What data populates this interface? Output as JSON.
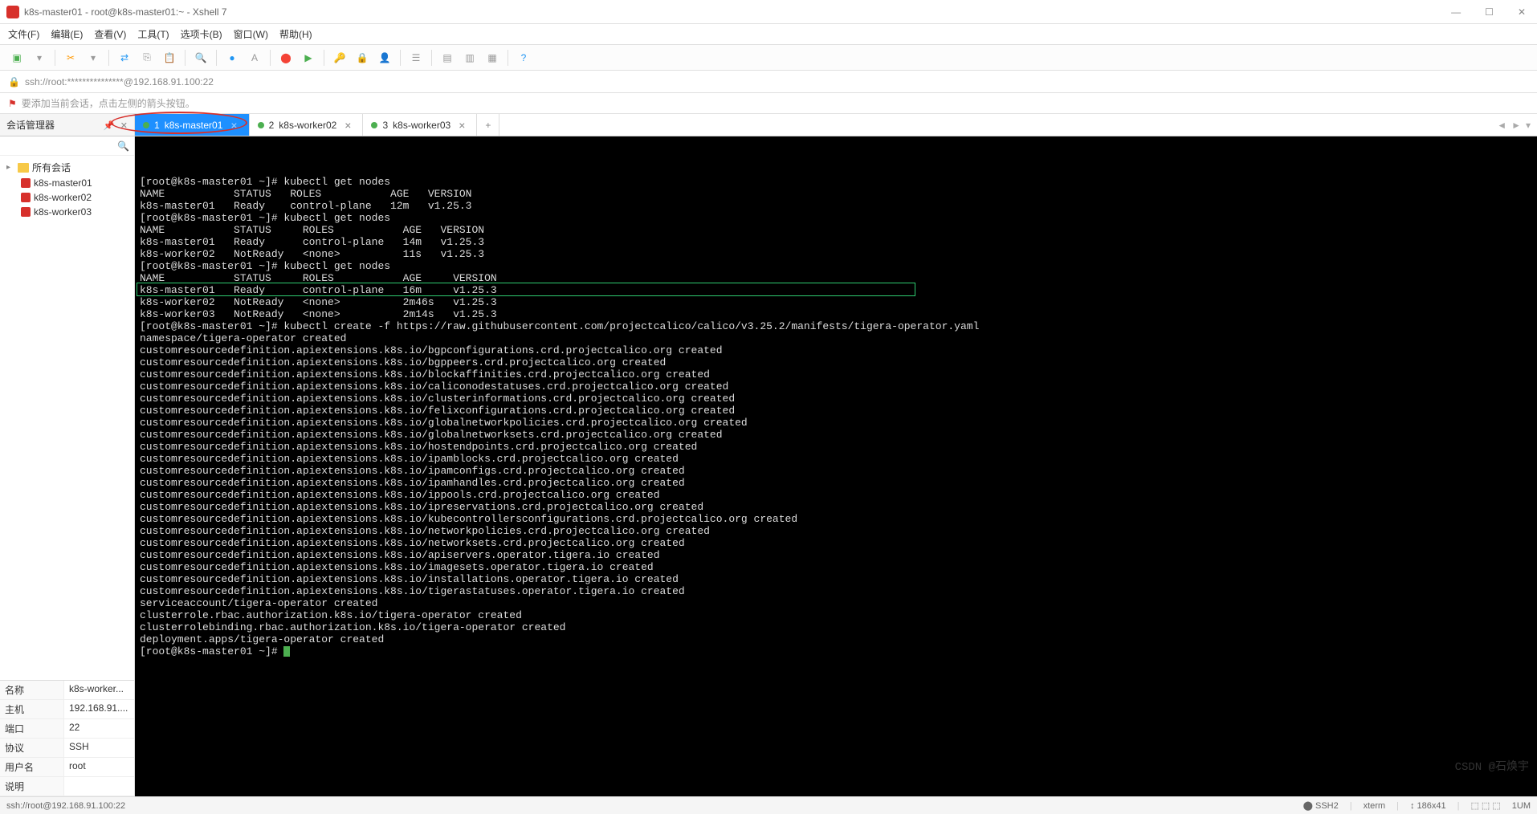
{
  "window": {
    "title": "k8s-master01 - root@k8s-master01:~ - Xshell 7",
    "min": "—",
    "max": "☐",
    "close": "✕"
  },
  "menu": [
    "文件(F)",
    "编辑(E)",
    "查看(V)",
    "工具(T)",
    "选项卡(B)",
    "窗口(W)",
    "帮助(H)"
  ],
  "address": "ssh://root:***************@192.168.91.100:22",
  "hint": "要添加当前会话，点击左侧的箭头按钮。",
  "side_header": "会话管理器",
  "search_placeholder": "",
  "tree": {
    "root": "所有会话",
    "items": [
      "k8s-master01",
      "k8s-worker02",
      "k8s-worker03"
    ]
  },
  "props": [
    {
      "k": "名称",
      "v": "k8s-worker..."
    },
    {
      "k": "主机",
      "v": "192.168.91...."
    },
    {
      "k": "端口",
      "v": "22"
    },
    {
      "k": "协议",
      "v": "SSH"
    },
    {
      "k": "用户名",
      "v": "root"
    },
    {
      "k": "说明",
      "v": ""
    }
  ],
  "tabs": [
    {
      "num": "1",
      "label": "k8s-master01",
      "active": true
    },
    {
      "num": "2",
      "label": "k8s-worker02",
      "active": false
    },
    {
      "num": "3",
      "label": "k8s-worker03",
      "active": false
    }
  ],
  "terminal_lines": [
    "[root@k8s-master01 ~]# kubectl get nodes",
    "NAME           STATUS   ROLES           AGE   VERSION",
    "k8s-master01   Ready    control-plane   12m   v1.25.3",
    "[root@k8s-master01 ~]# kubectl get nodes",
    "NAME           STATUS     ROLES           AGE   VERSION",
    "k8s-master01   Ready      control-plane   14m   v1.25.3",
    "k8s-worker02   NotReady   <none>          11s   v1.25.3",
    "[root@k8s-master01 ~]# kubectl get nodes",
    "NAME           STATUS     ROLES           AGE     VERSION",
    "k8s-master01   Ready      control-plane   16m     v1.25.3",
    "k8s-worker02   NotReady   <none>          2m46s   v1.25.3",
    "k8s-worker03   NotReady   <none>          2m14s   v1.25.3",
    "[root@k8s-master01 ~]# kubectl create -f https://raw.githubusercontent.com/projectcalico/calico/v3.25.2/manifests/tigera-operator.yaml",
    "namespace/tigera-operator created",
    "customresourcedefinition.apiextensions.k8s.io/bgpconfigurations.crd.projectcalico.org created",
    "customresourcedefinition.apiextensions.k8s.io/bgppeers.crd.projectcalico.org created",
    "customresourcedefinition.apiextensions.k8s.io/blockaffinities.crd.projectcalico.org created",
    "customresourcedefinition.apiextensions.k8s.io/caliconodestatuses.crd.projectcalico.org created",
    "customresourcedefinition.apiextensions.k8s.io/clusterinformations.crd.projectcalico.org created",
    "customresourcedefinition.apiextensions.k8s.io/felixconfigurations.crd.projectcalico.org created",
    "customresourcedefinition.apiextensions.k8s.io/globalnetworkpolicies.crd.projectcalico.org created",
    "customresourcedefinition.apiextensions.k8s.io/globalnetworksets.crd.projectcalico.org created",
    "customresourcedefinition.apiextensions.k8s.io/hostendpoints.crd.projectcalico.org created",
    "customresourcedefinition.apiextensions.k8s.io/ipamblocks.crd.projectcalico.org created",
    "customresourcedefinition.apiextensions.k8s.io/ipamconfigs.crd.projectcalico.org created",
    "customresourcedefinition.apiextensions.k8s.io/ipamhandles.crd.projectcalico.org created",
    "customresourcedefinition.apiextensions.k8s.io/ippools.crd.projectcalico.org created",
    "customresourcedefinition.apiextensions.k8s.io/ipreservations.crd.projectcalico.org created",
    "customresourcedefinition.apiextensions.k8s.io/kubecontrollersconfigurations.crd.projectcalico.org created",
    "customresourcedefinition.apiextensions.k8s.io/networkpolicies.crd.projectcalico.org created",
    "customresourcedefinition.apiextensions.k8s.io/networksets.crd.projectcalico.org created",
    "customresourcedefinition.apiextensions.k8s.io/apiservers.operator.tigera.io created",
    "customresourcedefinition.apiextensions.k8s.io/imagesets.operator.tigera.io created",
    "customresourcedefinition.apiextensions.k8s.io/installations.operator.tigera.io created",
    "customresourcedefinition.apiextensions.k8s.io/tigerastatuses.operator.tigera.io created",
    "serviceaccount/tigera-operator created",
    "clusterrole.rbac.authorization.k8s.io/tigera-operator created",
    "clusterrolebinding.rbac.authorization.k8s.io/tigera-operator created",
    "deployment.apps/tigera-operator created",
    "[root@k8s-master01 ~]# "
  ],
  "highlight_line_index": 12,
  "statusbar": {
    "left": "ssh://root@192.168.91.100:22",
    "ssh_icon": "⬤ SSH2",
    "term": "xterm",
    "size": "↕ 186x41",
    "encoding": "⬚ ⬚ ⬚",
    "num": "1UM"
  },
  "watermark": "CSDN @石焕宇"
}
